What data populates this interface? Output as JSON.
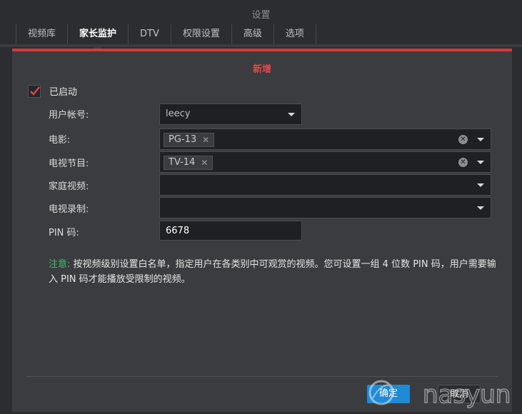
{
  "window": {
    "title": "设置"
  },
  "tabs": [
    {
      "label": "视频库"
    },
    {
      "label": "家长监护"
    },
    {
      "label": "DTV"
    },
    {
      "label": "权限设置"
    },
    {
      "label": "高级"
    },
    {
      "label": "选项"
    }
  ],
  "active_tab": "家长监护",
  "dialog": {
    "title": "新增",
    "enabled_label": "已启动",
    "enabled": true,
    "fields": {
      "user": {
        "label": "用户帐号:",
        "value": "leecy"
      },
      "movie": {
        "label": "电影:",
        "tag": "PG-13"
      },
      "tv_show": {
        "label": "电视节目:",
        "tag": "TV-14"
      },
      "home_video": {
        "label": "家庭视频:"
      },
      "tv_recording": {
        "label": "电视录制:"
      },
      "pin": {
        "label": "PIN 码:",
        "value": "6678"
      }
    },
    "note_prefix": "注意:",
    "note_text": " 按视频级别设置白名单，指定用户在各类别中可观赏的视频。您可设置一组 4 位数 PIN 码，用户需要输入 PIN 码才能播放受限制的视频。",
    "ok_label": "确定",
    "cancel_label": "取消"
  },
  "colors": {
    "accent_red": "#d33a3a",
    "title_red": "#e04848",
    "note_green": "#3fbf74",
    "ok_blue": "#1f8ad6"
  },
  "watermark": "nasyun"
}
